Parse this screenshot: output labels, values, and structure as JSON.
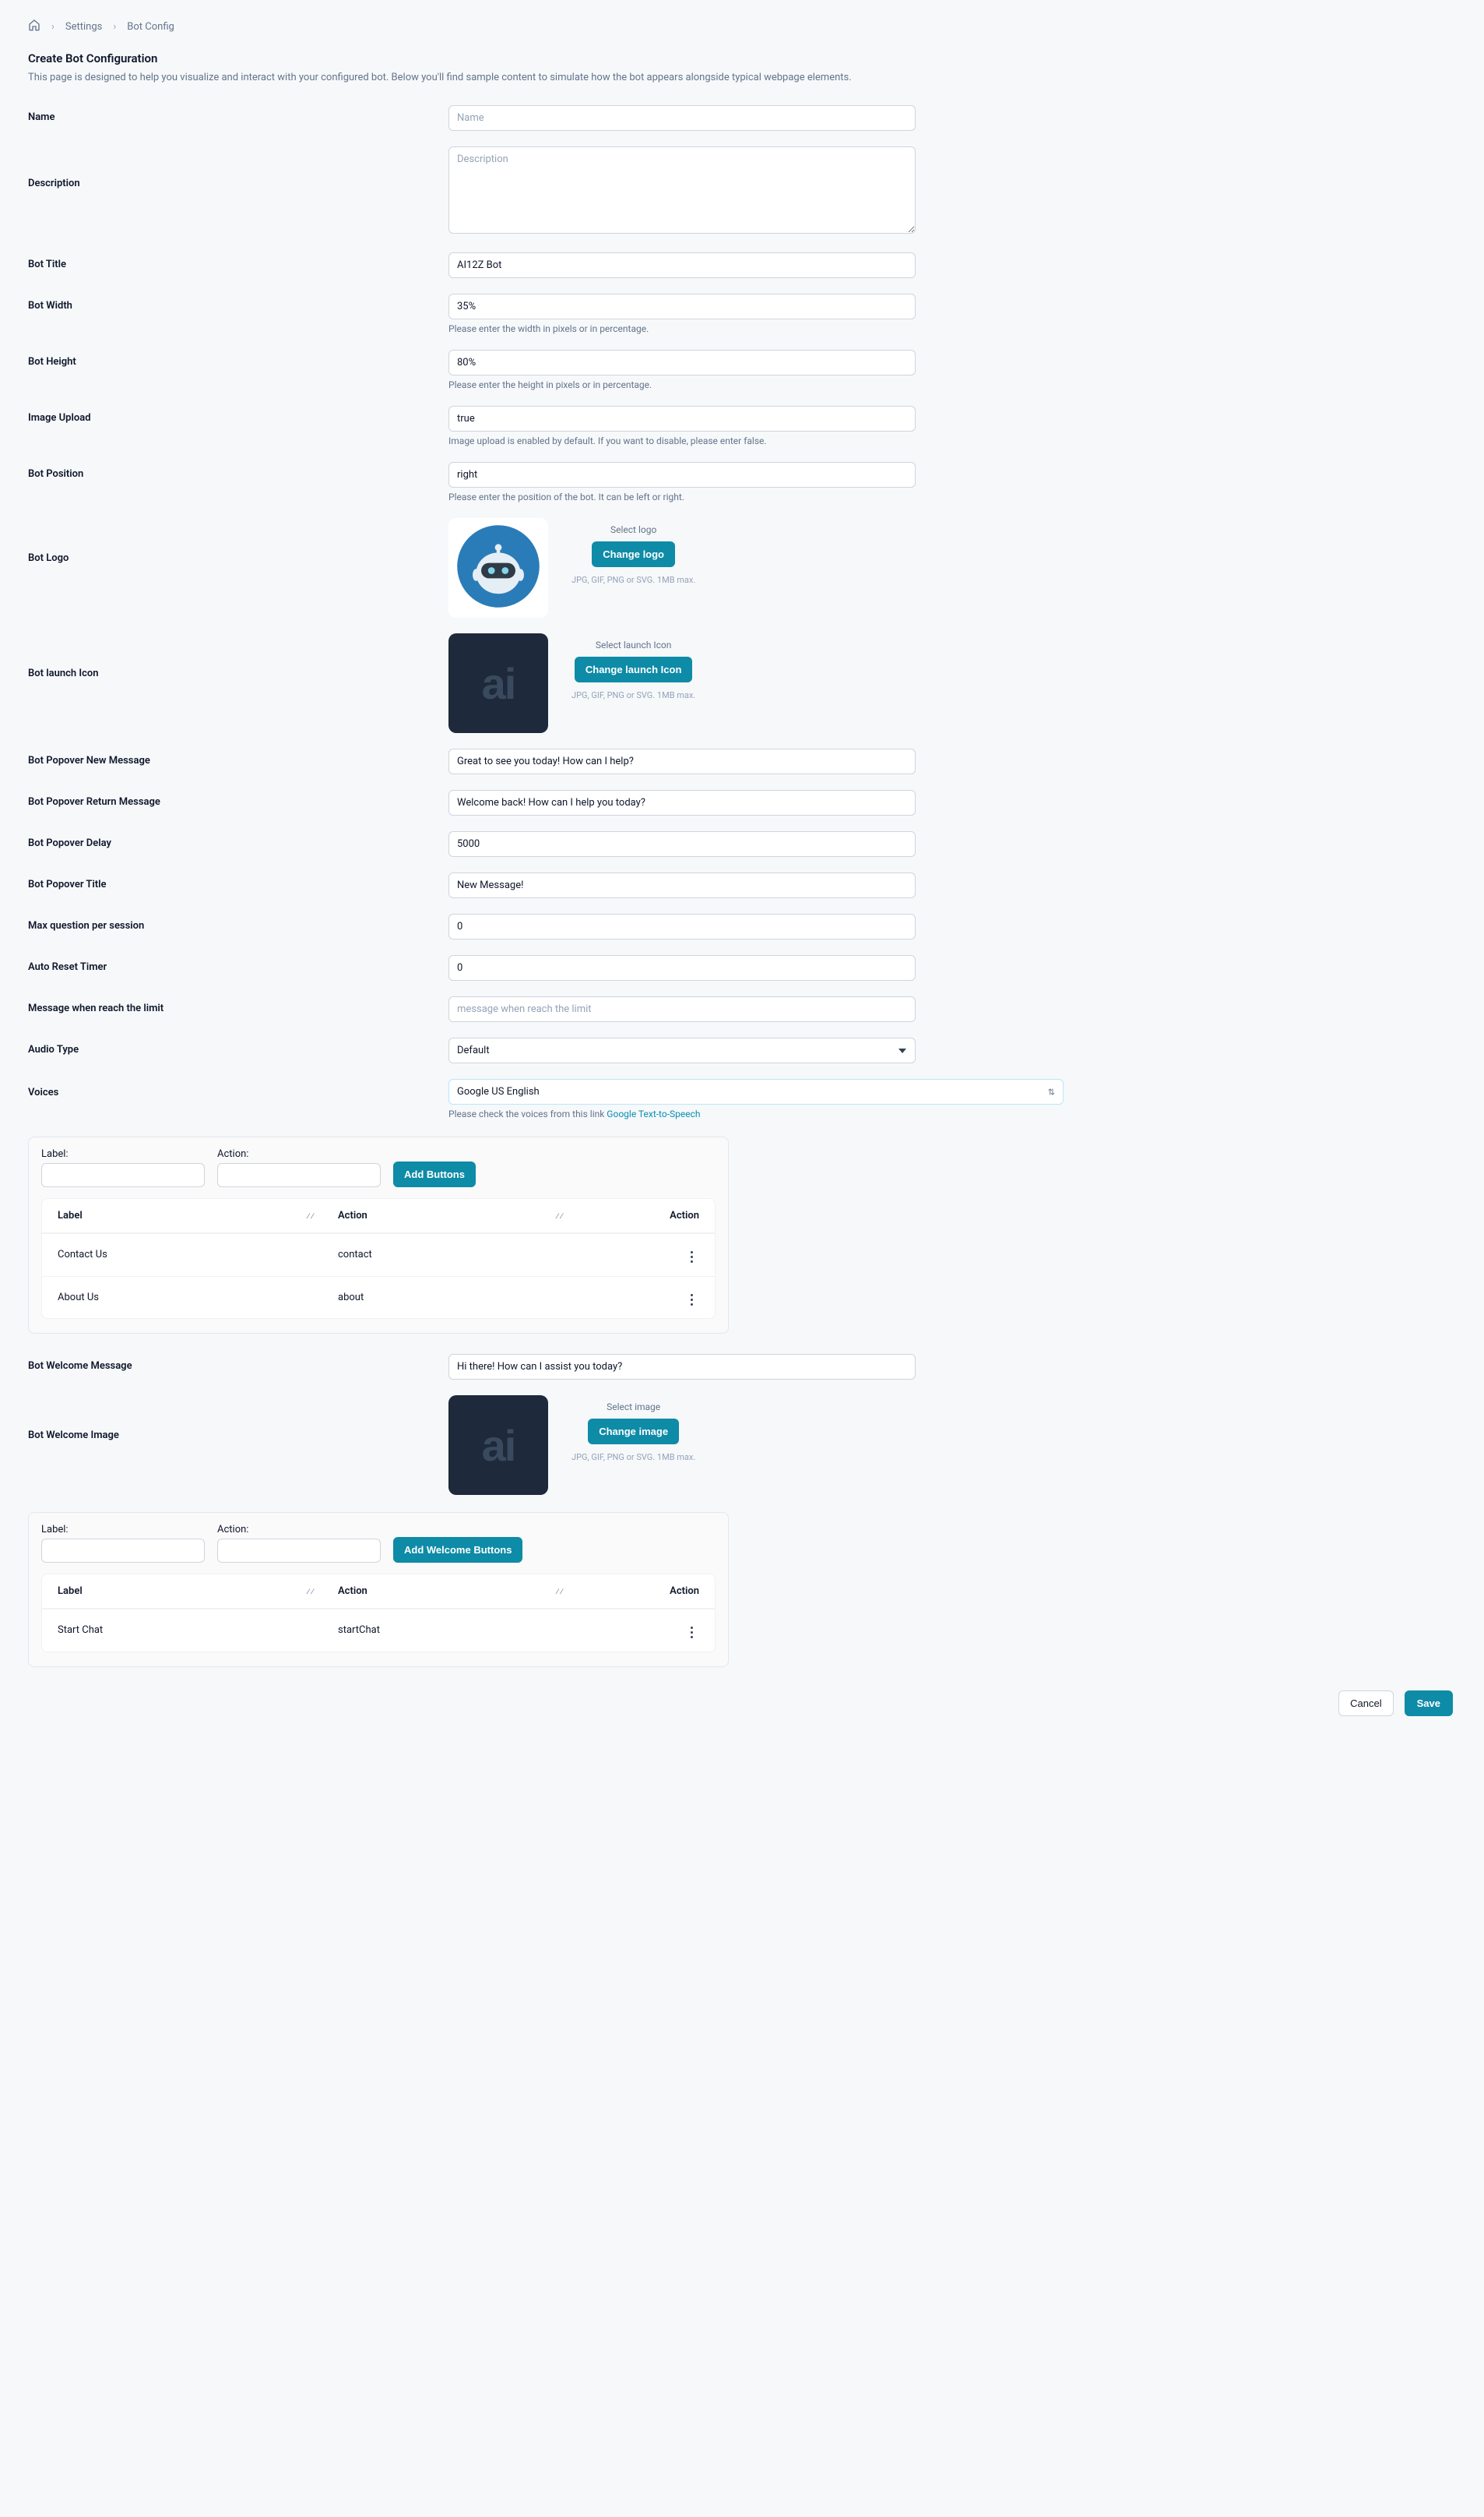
{
  "breadcrumb": {
    "settings": "Settings",
    "bot_config": "Bot Config"
  },
  "page": {
    "title": "Create Bot Configuration",
    "subtitle": "This page is designed to help you visualize and interact with your configured bot. Below you'll find sample content to simulate how the bot appears alongside typical webpage elements."
  },
  "labels": {
    "name": "Name",
    "description": "Description",
    "bot_title": "Bot Title",
    "bot_width": "Bot Width",
    "bot_height": "Bot Height",
    "image_upload": "Image Upload",
    "bot_position": "Bot Position",
    "bot_logo": "Bot Logo",
    "bot_launch_icon": "Bot launch Icon",
    "popover_new": "Bot Popover New Message",
    "popover_return": "Bot Popover Return Message",
    "popover_delay": "Bot Popover Delay",
    "popover_title": "Bot Popover Title",
    "max_question": "Max question per session",
    "auto_reset": "Auto Reset Timer",
    "limit_message": "Message when reach the limit",
    "audio_type": "Audio Type",
    "voices": "Voices",
    "welcome_msg": "Bot Welcome Message",
    "welcome_img": "Bot Welcome Image"
  },
  "placeholders": {
    "name": "Name",
    "description": "Description",
    "limit_message": "message when reach the limit"
  },
  "values": {
    "bot_title": "AI12Z Bot",
    "bot_width": "35%",
    "bot_height": "80%",
    "image_upload": "true",
    "bot_position": "right",
    "popover_new": "Great to see you today! How can I help?",
    "popover_return": "Welcome back! How can I help you today?",
    "popover_delay": "5000",
    "popover_title": "New Message!",
    "max_question": "0",
    "auto_reset": "0",
    "audio_type": "Default",
    "voices": "Google US English",
    "welcome_msg": "Hi there! How can I assist you today?"
  },
  "helps": {
    "bot_width": "Please enter the width in pixels or in percentage.",
    "bot_height": "Please enter the height in pixels or in percentage.",
    "image_upload": "Image upload is enabled by default. If you want to disable, please enter false.",
    "bot_position": "Please enter the position of the bot. It can be left or right.",
    "voices_prefix": "Please check the voices from this link ",
    "voices_link": "Google Text-to-Speech"
  },
  "media": {
    "select_logo": "Select logo",
    "change_logo": "Change logo",
    "select_launch": "Select launch Icon",
    "change_launch": "Change launch Icon",
    "select_image": "Select image",
    "change_image": "Change image",
    "file_hint": "JPG, GIF, PNG or SVG. 1MB max."
  },
  "buttons_section": {
    "label_label": "Label:",
    "action_label": "Action:",
    "add_buttons": "Add Buttons",
    "add_welcome_buttons": "Add Welcome Buttons",
    "th_label": "Label",
    "th_action": "Action",
    "th_action2": "Action"
  },
  "buttons_rows": [
    {
      "label": "Contact Us",
      "action": "contact"
    },
    {
      "label": "About Us",
      "action": "about"
    }
  ],
  "welcome_rows": [
    {
      "label": "Start Chat",
      "action": "startChat"
    }
  ],
  "footer": {
    "cancel": "Cancel",
    "save": "Save"
  }
}
